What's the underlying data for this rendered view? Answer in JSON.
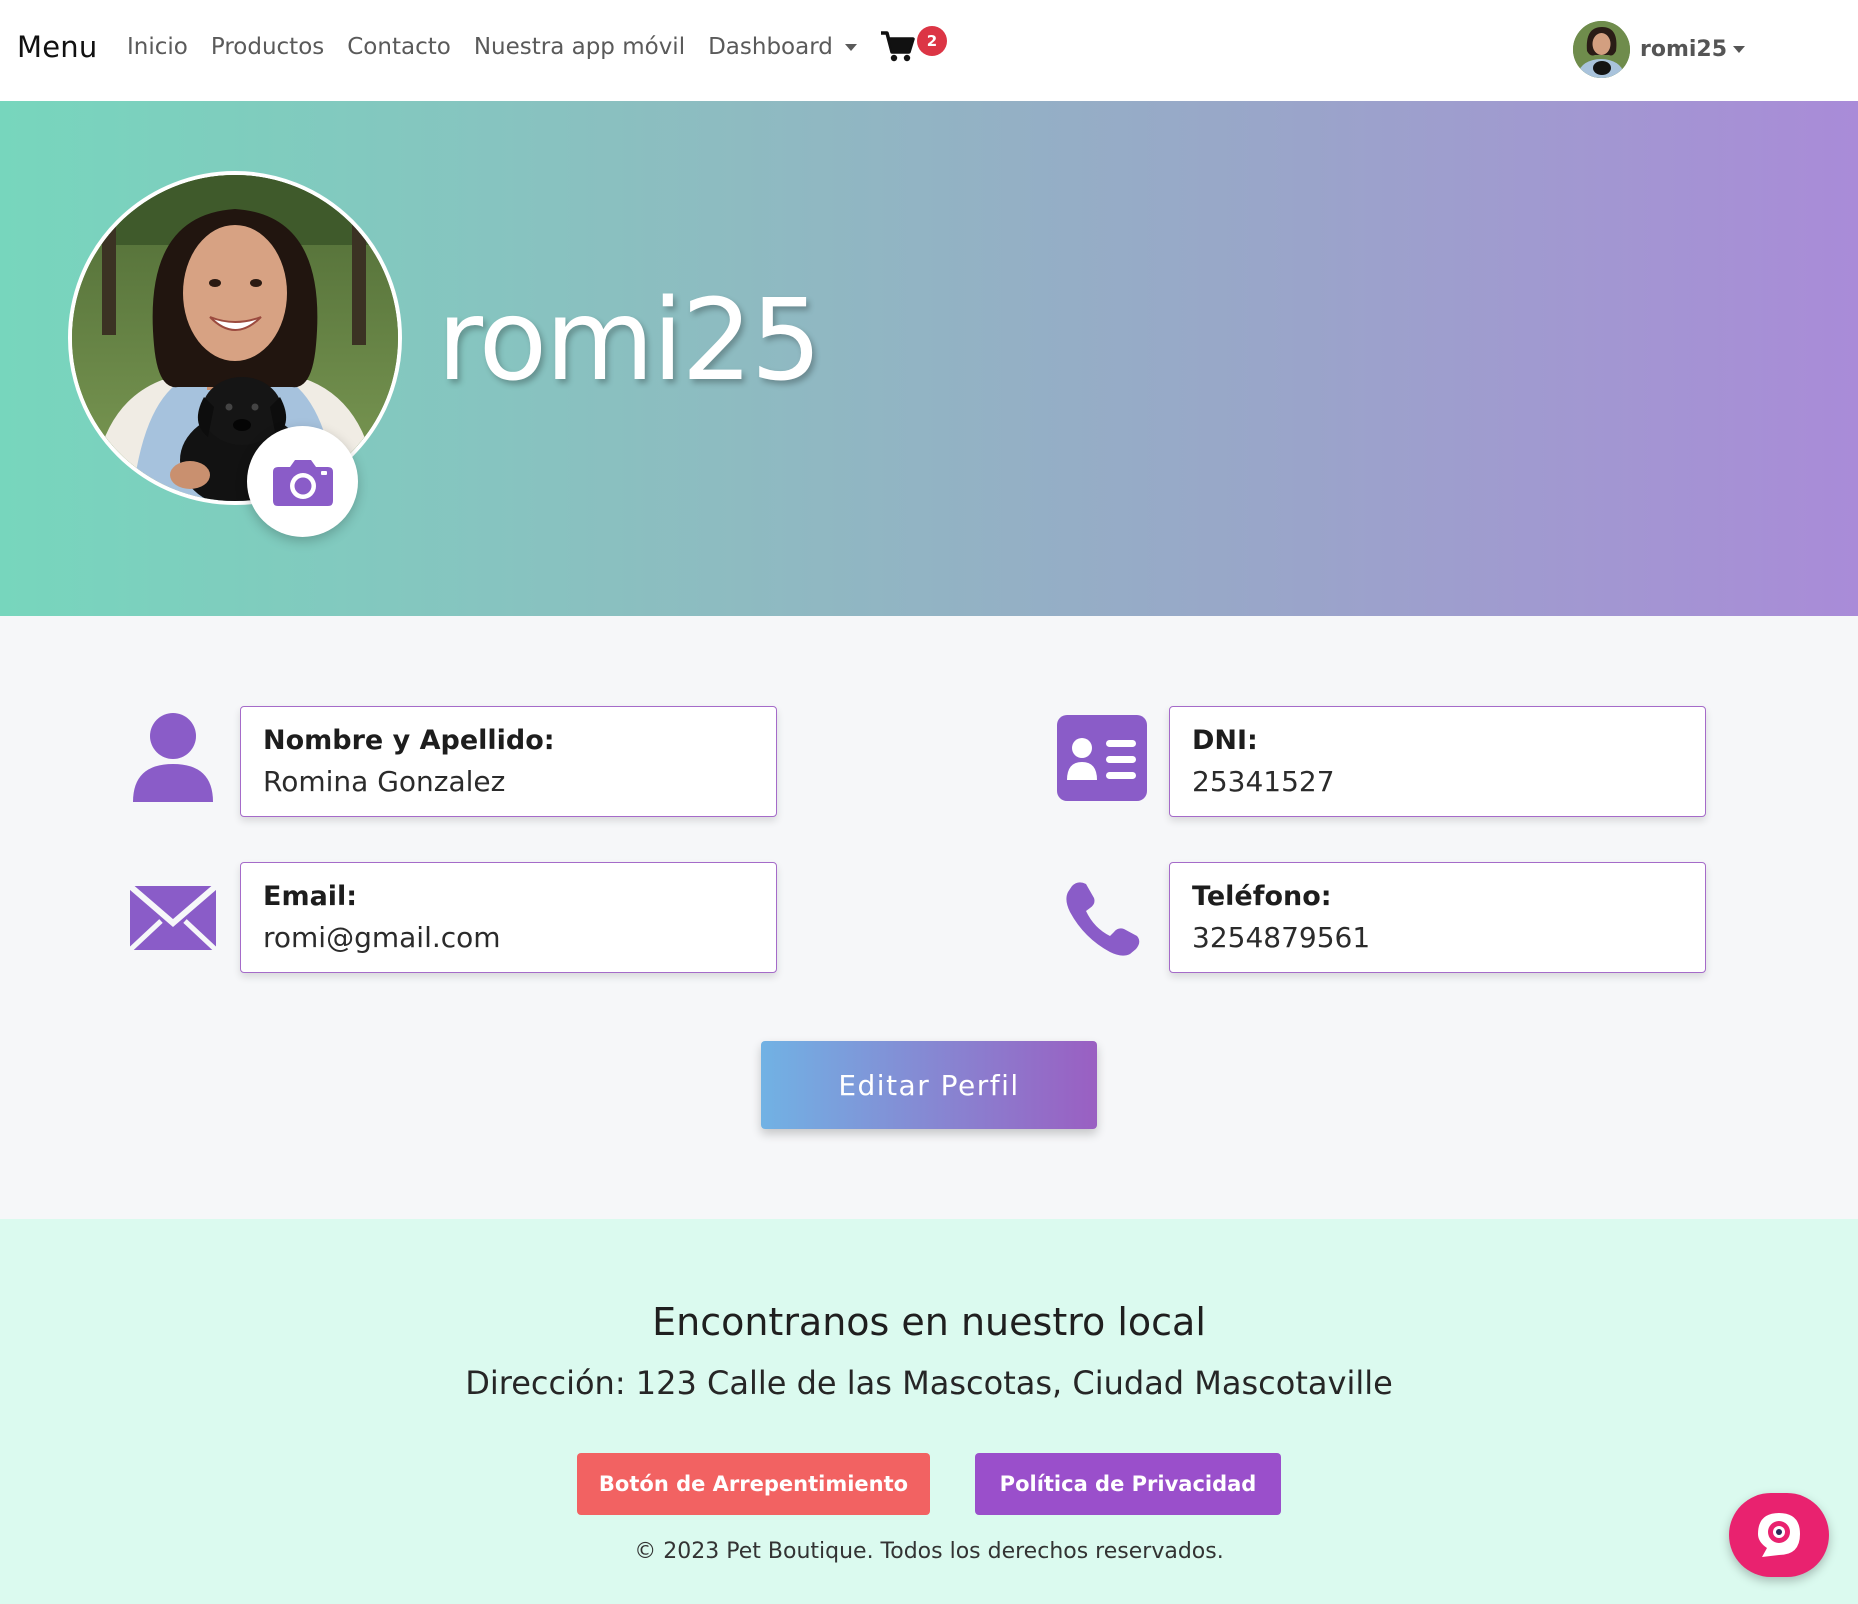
{
  "navbar": {
    "brand": "Menu",
    "links": [
      {
        "label": "Inicio"
      },
      {
        "label": "Productos"
      },
      {
        "label": "Contacto"
      },
      {
        "label": "Nuestra app móvil"
      },
      {
        "label": "Dashboard"
      }
    ],
    "cart": {
      "icon": "shopping-cart-icon",
      "count": "2"
    },
    "user": {
      "name": "romi25",
      "icon": "chevron-down-icon"
    }
  },
  "hero": {
    "username": "romi25",
    "camera_icon": "camera-icon",
    "gradient": [
      "#77d6bd",
      "#a98bd8"
    ]
  },
  "profile": {
    "name": {
      "label": "Nombre y Apellido:",
      "value": "Romina Gonzalez",
      "icon": "user-icon"
    },
    "dni": {
      "label": "DNI:",
      "value": "25341527",
      "icon": "id-card-icon"
    },
    "email": {
      "label": "Email:",
      "value": "romi@gmail.com",
      "icon": "envelope-icon"
    },
    "phone": {
      "label": "Teléfono:",
      "value": "3254879561",
      "icon": "phone-icon"
    },
    "edit_button": "Editar Perfil"
  },
  "footer": {
    "title": "Encontranos en nuestro local",
    "address": "Dirección: 123 Calle de las Mascotas, Ciudad Mascotaville",
    "regret_button": "Botón de Arrepentimiento",
    "privacy_button": "Política de Privacidad",
    "copyright": "© 2023 Pet Boutique. Todos los derechos reservados."
  },
  "colors": {
    "accent": "#8a5cc8",
    "badge": "#dc3545",
    "regret": "#f26262",
    "privacy": "#9a4fcb",
    "chat": "#e9226f",
    "footer_bg": "#dbfaef"
  },
  "chat_widget": {
    "icon": "chat-bubble-icon"
  }
}
